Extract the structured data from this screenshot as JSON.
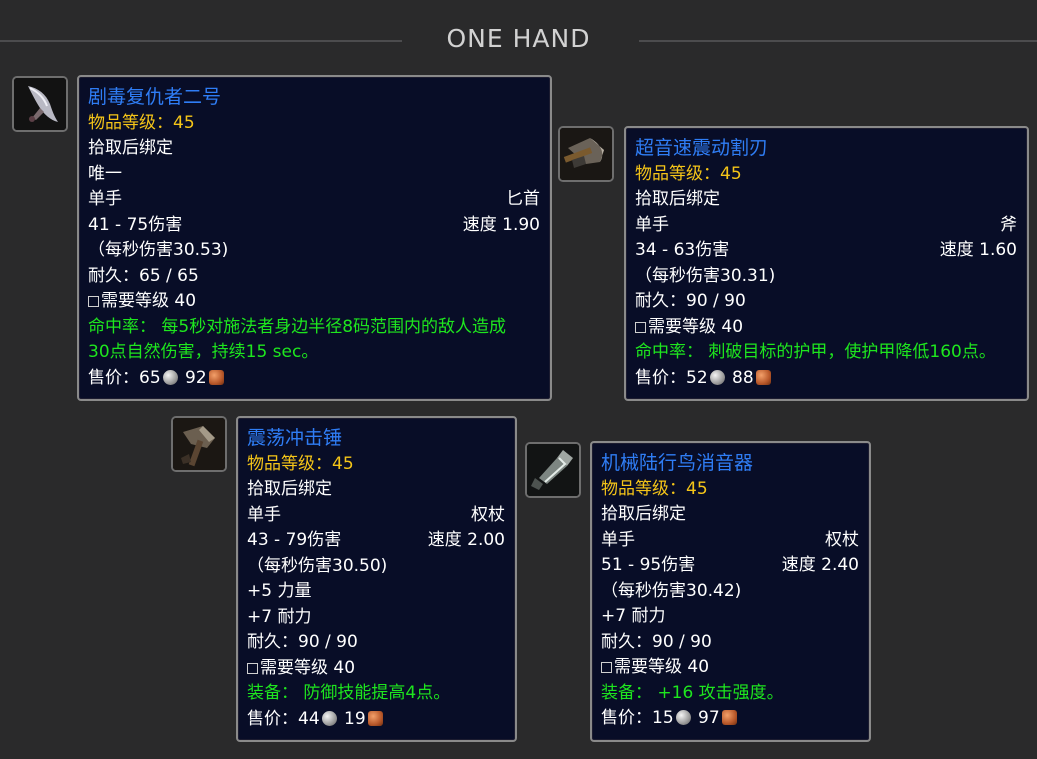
{
  "section": {
    "title": "ONE HAND"
  },
  "items": [
    {
      "icon": "dagger-icon",
      "name": "剧毒复仇者二号",
      "item_level": "物品等级：45",
      "bind": "拾取后绑定",
      "unique": "唯一",
      "slot": "单手",
      "type": "匕首",
      "damage": "41 - 75伤害",
      "speed": "速度 1.90",
      "dps": "（每秒伤害30.53)",
      "durability": "耐久：65 / 65",
      "required_level": "需要等级 40",
      "effect_line1": "命中率：  每5秒对施法者身边半径8码范围内的敌人造成",
      "effect_line2": "30点自然伤害，持续15 sec。",
      "price_label": "售价：",
      "silver": "65",
      "copper": "92"
    },
    {
      "icon": "axe-icon",
      "name": "超音速震动割刃",
      "item_level": "物品等级：45",
      "bind": "拾取后绑定",
      "slot": "单手",
      "type": "斧",
      "damage": "34 - 63伤害",
      "speed": "速度 1.60",
      "dps": "（每秒伤害30.31)",
      "durability": "耐久：90 / 90",
      "required_level": "需要等级 40",
      "effect_line1": "命中率：  刺破目标的护甲，使护甲降低160点。",
      "price_label": "售价：",
      "silver": "52",
      "copper": "88"
    },
    {
      "icon": "hammer-icon",
      "name": "震荡冲击锤",
      "item_level": "物品等级：45",
      "bind": "拾取后绑定",
      "slot": "单手",
      "type": "权杖",
      "damage": "43 - 79伤害",
      "speed": "速度 2.00",
      "dps": "（每秒伤害30.50)",
      "stat1": "+5 力量",
      "stat2": "+7 耐力",
      "durability": "耐久：90 / 90",
      "required_level": "需要等级 40",
      "effect_line1": "装备：  防御技能提高4点。",
      "price_label": "售价：",
      "silver": "44",
      "copper": "19"
    },
    {
      "icon": "mace-icon",
      "name": "机械陆行鸟消音器",
      "item_level": "物品等级：45",
      "bind": "拾取后绑定",
      "slot": "单手",
      "type": "权杖",
      "damage": "51 - 95伤害",
      "speed": "速度 2.40",
      "dps": "（每秒伤害30.42)",
      "stat1": "+7 耐力",
      "durability": "耐久：90 / 90",
      "required_level": "需要等级 40",
      "effect_line1": "装备：  +16 攻击强度。",
      "price_label": "售价：",
      "silver": "15",
      "copper": "97"
    }
  ],
  "colors": {
    "name": "#2f7df5",
    "item_level": "#f5c518",
    "effect": "#1ee61e",
    "background": "#2a2a2b",
    "tooltip_bg": "#080d27"
  }
}
